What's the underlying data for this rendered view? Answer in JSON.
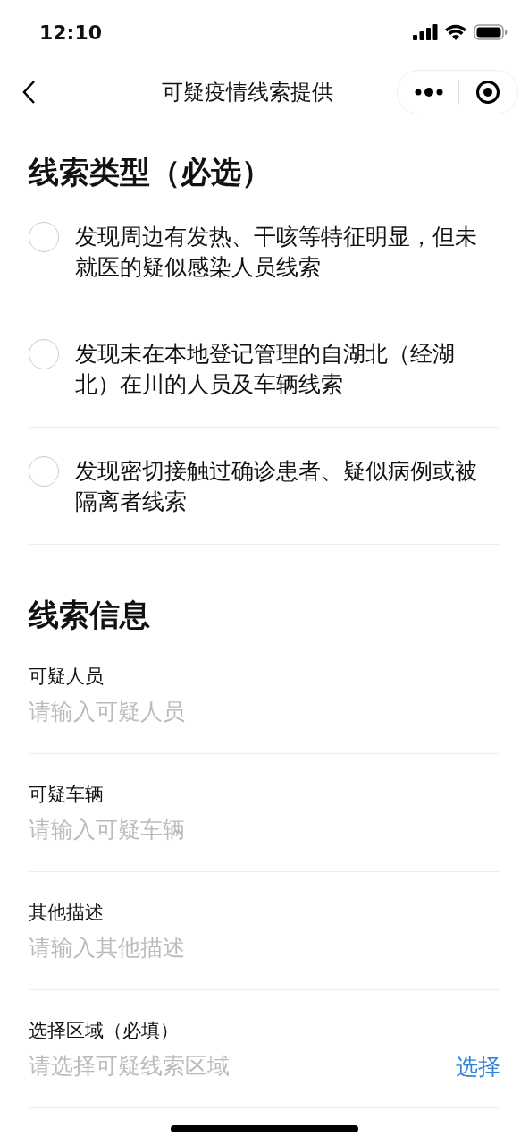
{
  "status_bar": {
    "time": "12:10"
  },
  "nav": {
    "title": "可疑疫情线索提供"
  },
  "clue_type": {
    "title": "线索类型（必选）",
    "options": [
      {
        "label": "发现周边有发热、干咳等特征明显，但未就医的疑似感染人员线索",
        "selected": false
      },
      {
        "label": "发现未在本地登记管理的自湖北（经湖北）在川的人员及车辆线索",
        "selected": false
      },
      {
        "label": "发现密切接触过确诊患者、疑似病例或被隔离者线索",
        "selected": false
      }
    ]
  },
  "clue_info": {
    "title": "线索信息",
    "fields": [
      {
        "label": "可疑人员",
        "placeholder": "请输入可疑人员"
      },
      {
        "label": "可疑车辆",
        "placeholder": "请输入可疑车辆"
      },
      {
        "label": "其他描述",
        "placeholder": "请输入其他描述"
      },
      {
        "label": "选择区域（必填）",
        "placeholder": "请选择可疑线索区域",
        "action": "选择"
      }
    ]
  }
}
